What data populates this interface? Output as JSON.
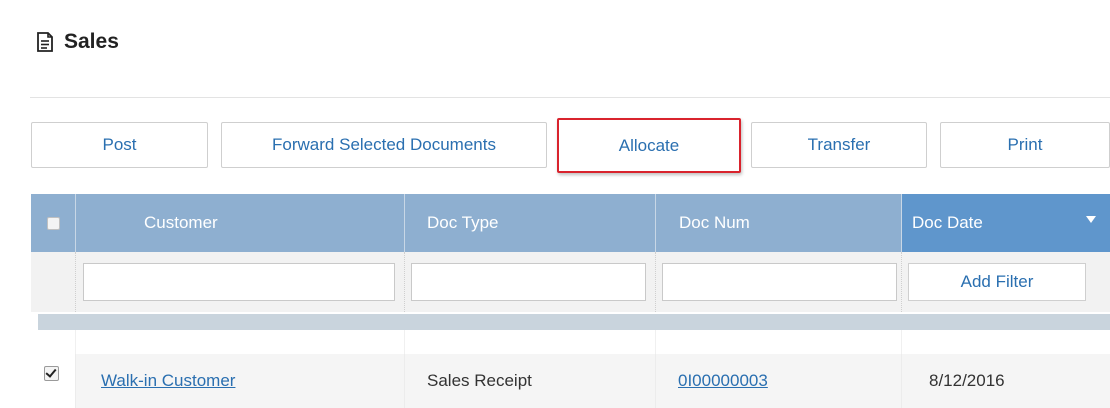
{
  "page": {
    "title": "Sales",
    "title_icon": "document-icon"
  },
  "toolbar": {
    "post_label": "Post",
    "forward_label": "Forward Selected Documents",
    "allocate_label": "Allocate",
    "transfer_label": "Transfer",
    "print_label": "Print",
    "highlight_color": "#d9232d"
  },
  "grid": {
    "columns": {
      "customer": "Customer",
      "doc_type": "Doc Type",
      "doc_num": "Doc Num",
      "doc_date": "Doc Date"
    },
    "sorted_column": "Doc Date",
    "sort_direction": "descending",
    "filter": {
      "customer_value": "",
      "doc_type_value": "",
      "doc_num_value": "",
      "add_filter_label": "Add Filter"
    },
    "rows": [
      {
        "checked": true,
        "customer": "Walk-in Customer",
        "doc_type": "Sales Receipt",
        "doc_num": "0I00000003",
        "doc_date": "8/12/2016"
      }
    ]
  },
  "colors": {
    "header_bg": "#8eafd0",
    "sorted_header_bg": "#5f96cc",
    "link": "#2a6fb0"
  }
}
